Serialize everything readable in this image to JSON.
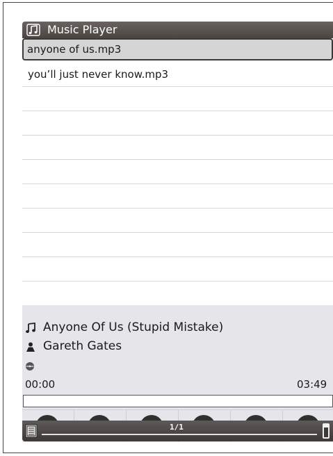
{
  "app": {
    "title": "Music Player"
  },
  "playlist": {
    "items": [
      {
        "label": "anyone of us.mp3",
        "selected": true
      },
      {
        "label": "you’ll just never know.mp3",
        "selected": false
      }
    ],
    "empty_rows": 8
  },
  "now_playing": {
    "title": "Anyone Of Us (Stupid Mistake)",
    "artist": "Gareth Gates",
    "album": "",
    "elapsed": "00:00",
    "duration": "03:49",
    "progress_fraction": 0
  },
  "controls": [
    {
      "name": "repeat",
      "icon": "repeat-icon"
    },
    {
      "name": "previous",
      "icon": "previous-icon"
    },
    {
      "name": "pause",
      "icon": "pause-icon"
    },
    {
      "name": "next",
      "icon": "next-icon"
    },
    {
      "name": "minimize",
      "icon": "minimize-icon"
    },
    {
      "name": "exit",
      "icon": "exit-icon"
    }
  ],
  "statusbar": {
    "page": "1/1"
  },
  "colors": {
    "titlebar": "#4a4442",
    "selected_row": "#d5d5d5",
    "panel": "#e6e6ea",
    "button": "#303030"
  }
}
